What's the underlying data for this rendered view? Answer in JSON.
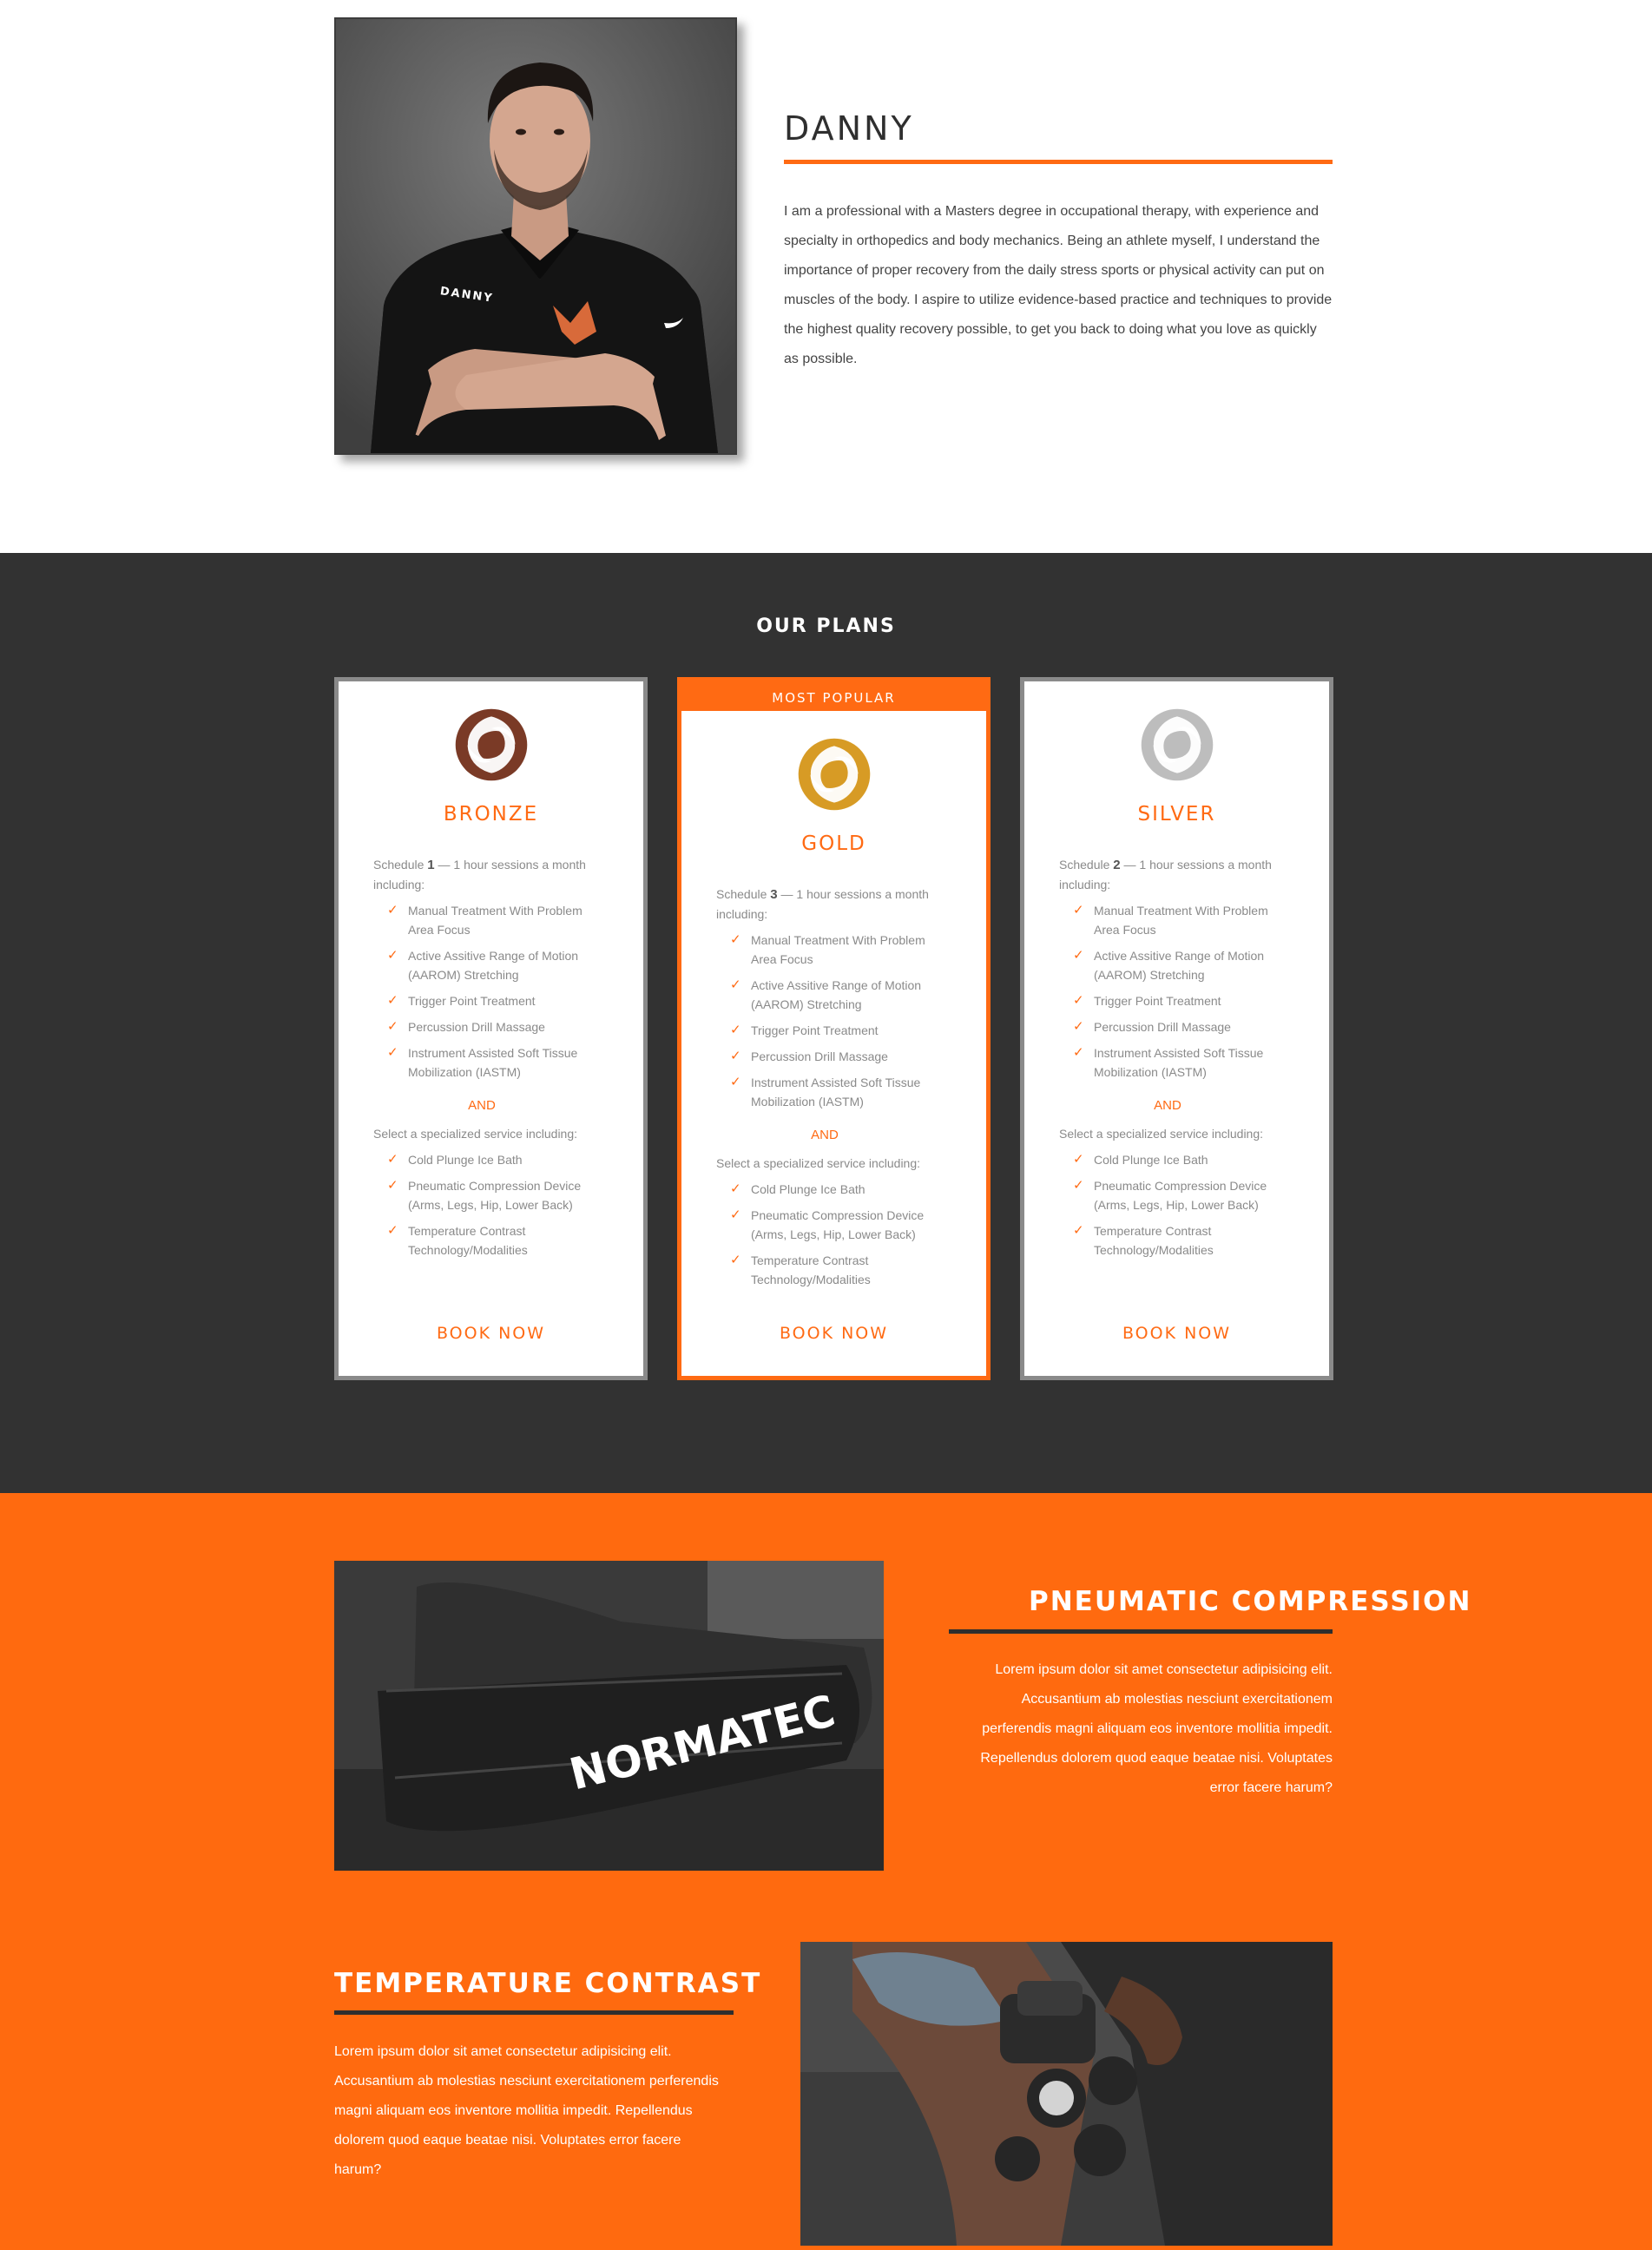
{
  "about": {
    "name": "DANNY",
    "shirt_text": "DANNY",
    "bio": "I am a professional with a Masters degree in occupational therapy, with experience and specialty in orthopedics and body mechanics. Being an athlete myself, I understand the importance of proper recovery from the daily stress sports or physical activity can put on muscles of the body. I aspire to utilize evidence-based practice and techniques to provide the highest quality recovery possible, to get you back to doing what you love as quickly as possible."
  },
  "plans": {
    "title": "OUR PLANS",
    "popular_badge": "MOST POPULAR",
    "cards": [
      {
        "name": "BRONZE",
        "logo_color": "#7a3a26",
        "schedule_prefix": "Schedule ",
        "schedule_count": "1",
        "schedule_suffix": " — 1 hour sessions a month including:",
        "features": [
          "Manual Treatment With Problem Area Focus",
          "Active Assitive Range of Motion (AAROM) Stretching",
          "Trigger Point Treatment",
          "Percussion Drill Massage",
          "Instrument Assisted Soft Tissue Mobilization (IASTM)"
        ],
        "and_label": "AND",
        "select_label": "Select a specialized service including:",
        "services": [
          "Cold Plunge Ice Bath",
          "Pneumatic Compression Device (Arms, Legs, Hip, Lower Back)",
          "Temperature Contrast Technology/Modalities"
        ],
        "book": "BOOK NOW"
      },
      {
        "name": "GOLD",
        "logo_color": "#d79b25",
        "schedule_prefix": "Schedule ",
        "schedule_count": "3",
        "schedule_suffix": " — 1 hour sessions a month including:",
        "features": [
          "Manual Treatment With Problem Area Focus",
          "Active Assitive Range of Motion (AAROM) Stretching",
          "Trigger Point Treatment",
          "Percussion Drill Massage",
          "Instrument Assisted Soft Tissue Mobilization (IASTM)"
        ],
        "and_label": "AND",
        "select_label": "Select a specialized service including:",
        "services": [
          "Cold Plunge Ice Bath",
          "Pneumatic Compression Device (Arms, Legs, Hip, Lower Back)",
          "Temperature Contrast Technology/Modalities"
        ],
        "book": "BOOK NOW"
      },
      {
        "name": "SILVER",
        "logo_color": "#bdbdbd",
        "schedule_prefix": "Schedule ",
        "schedule_count": "2",
        "schedule_suffix": " — 1 hour sessions a month including:",
        "features": [
          "Manual Treatment With Problem Area Focus",
          "Active Assitive Range of Motion (AAROM) Stretching",
          "Trigger Point Treatment",
          "Percussion Drill Massage",
          "Instrument Assisted Soft Tissue Mobilization (IASTM)"
        ],
        "and_label": "AND",
        "select_label": "Select a specialized service including:",
        "services": [
          "Cold Plunge Ice Bath",
          "Pneumatic Compression Device (Arms, Legs, Hip, Lower Back)",
          "Temperature Contrast Technology/Modalities"
        ],
        "book": "BOOK NOW"
      }
    ]
  },
  "services": {
    "pneumatic": {
      "title": "PNEUMATIC COMPRESSION",
      "brand_text": "NORMATEC",
      "text": "Lorem ipsum dolor sit amet consectetur adipisicing elit. Accusantium ab molestias nesciunt exercitationem perferendis magni aliquam eos inventore mollitia impedit. Repellendus dolorem quod eaque beatae nisi. Voluptates error facere harum?"
    },
    "temperature": {
      "title": "TEMPERATURE CONTRAST",
      "text": "Lorem ipsum dolor sit amet consectetur adipisicing elit. Accusantium ab molestias nesciunt exercitationem perferendis magni aliquam eos inventore mollitia impedit. Repellendus dolorem quod eaque beatae nisi. Voluptates error facere harum?"
    }
  },
  "colors": {
    "accent": "#ff6a13",
    "dark": "#323232",
    "orange_bg": "#ff6a0f"
  }
}
